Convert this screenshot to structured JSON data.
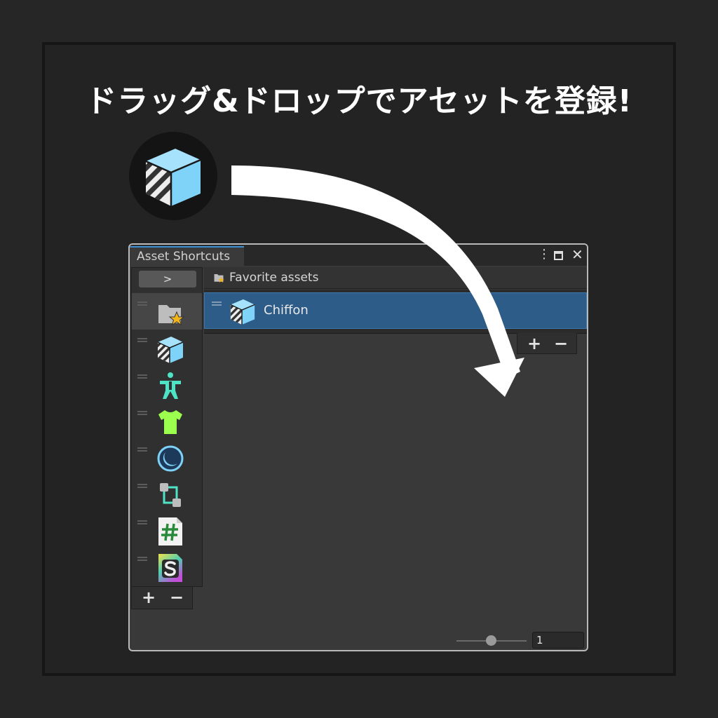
{
  "headline": "ドラッグ&ドロップでアセットを登録!",
  "window": {
    "tab_title": "Asset Shortcuts",
    "menu_glyph": "⋮",
    "close_glyph": "✕"
  },
  "sidebar": {
    "expand_label": ">",
    "items": [
      {
        "icon": "folder-star-icon",
        "selected": true
      },
      {
        "icon": "prefab-cube-icon"
      },
      {
        "icon": "humanoid-avatar-icon"
      },
      {
        "icon": "tshirt-icon"
      },
      {
        "icon": "moon-circle-icon"
      },
      {
        "icon": "node-graph-icon"
      },
      {
        "icon": "csharp-script-icon"
      },
      {
        "icon": "shader-s-icon"
      }
    ],
    "add_label": "+",
    "remove_label": "−"
  },
  "main": {
    "header_label": "Favorite assets",
    "assets": [
      {
        "name": "Chiffon",
        "icon": "prefab-cube-icon",
        "selected": true
      }
    ],
    "add_label": "+",
    "remove_label": "−"
  },
  "footer": {
    "zoom_value": "1"
  },
  "colors": {
    "selection": "#2c5c87",
    "tab_accent": "#3d8fd1",
    "cube_blue": "#7fd2f7",
    "humanoid_teal": "#4fe3c6",
    "shirt_green": "#9cff4e"
  }
}
